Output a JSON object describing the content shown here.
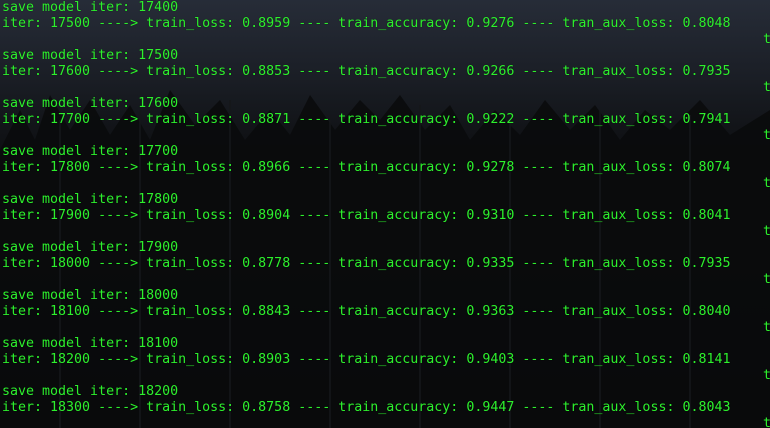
{
  "terminal": {
    "text_color": "#2df02d",
    "entries": [
      {
        "save": "save model iter: 17400",
        "iter": "iter: 17500 ----> train_loss: 0.8959 ---- train_accuracy: 0.9276 ---- tran_aux_loss: 0.8048",
        "wrap": "t"
      },
      {
        "save": "save model iter: 17500",
        "iter": "iter: 17600 ----> train_loss: 0.8853 ---- train_accuracy: 0.9266 ---- tran_aux_loss: 0.7935",
        "wrap": "t"
      },
      {
        "save": "save model iter: 17600",
        "iter": "iter: 17700 ----> train_loss: 0.8871 ---- train_accuracy: 0.9222 ---- tran_aux_loss: 0.7941",
        "wrap": "t"
      },
      {
        "save": "save model iter: 17700",
        "iter": "iter: 17800 ----> train_loss: 0.8966 ---- train_accuracy: 0.9278 ---- tran_aux_loss: 0.8074",
        "wrap": "t"
      },
      {
        "save": "save model iter: 17800",
        "iter": "iter: 17900 ----> train_loss: 0.8904 ---- train_accuracy: 0.9310 ---- tran_aux_loss: 0.8041",
        "wrap": "t"
      },
      {
        "save": "save model iter: 17900",
        "iter": "iter: 18000 ----> train_loss: 0.8778 ---- train_accuracy: 0.9335 ---- tran_aux_loss: 0.7935",
        "wrap": "t"
      },
      {
        "save": "save model iter: 18000",
        "iter": "iter: 18100 ----> train_loss: 0.8843 ---- train_accuracy: 0.9363 ---- tran_aux_loss: 0.8040",
        "wrap": "t"
      },
      {
        "save": "save model iter: 18100",
        "iter": "iter: 18200 ----> train_loss: 0.8903 ---- train_accuracy: 0.9403 ---- tran_aux_loss: 0.8141",
        "wrap": "t"
      },
      {
        "save": "save model iter: 18200",
        "iter": "iter: 18300 ----> train_loss: 0.8758 ---- train_accuracy: 0.9447 ---- tran_aux_loss: 0.8043",
        "wrap": "t"
      }
    ]
  }
}
